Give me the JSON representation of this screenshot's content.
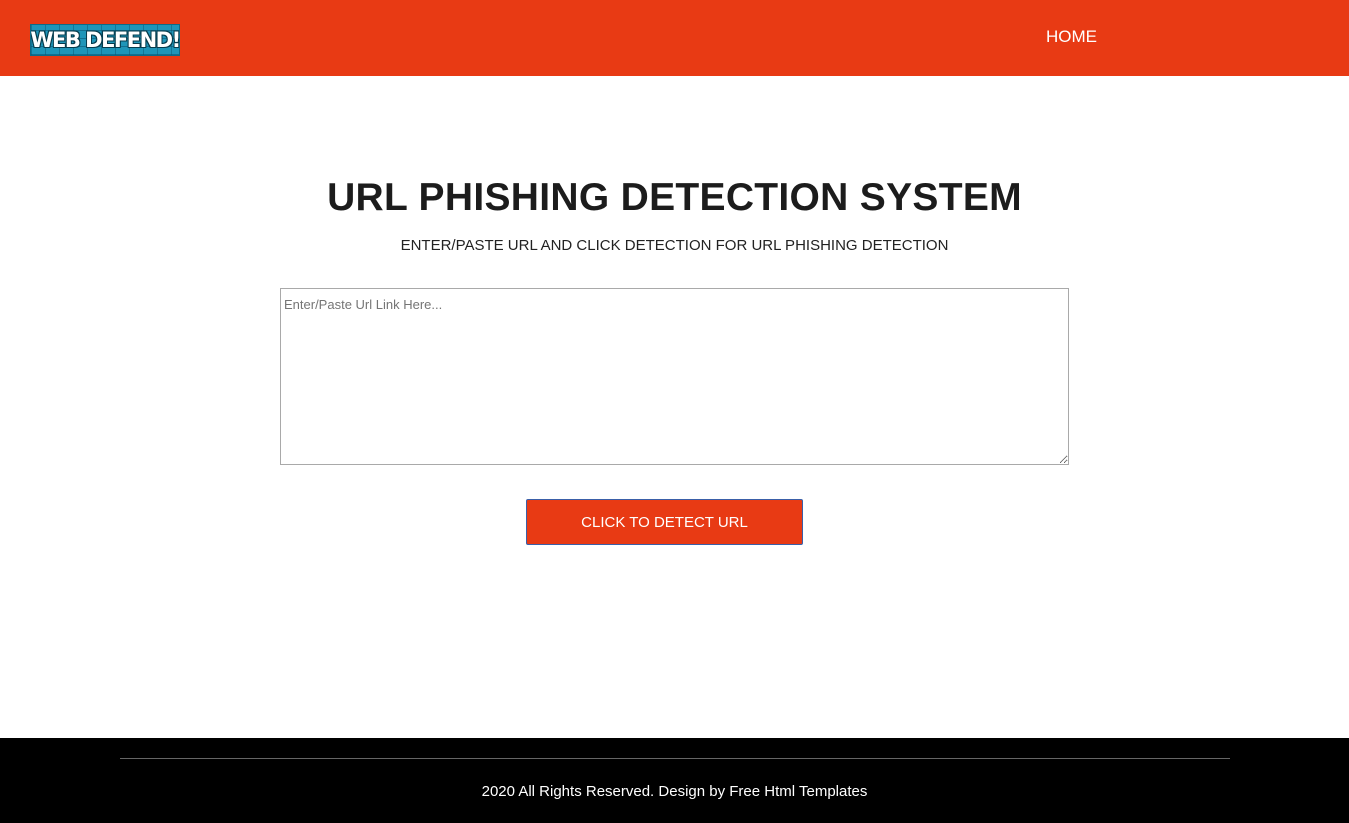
{
  "header": {
    "logo_text": "WEB DEFEND!",
    "nav": {
      "home_label": "HOME"
    },
    "background_color": "#e83a14"
  },
  "main": {
    "title": "URL PHISHING DETECTION SYSTEM",
    "subtitle": "ENTER/PASTE URL AND CLICK DETECTION FOR URL PHISHING DETECTION",
    "url_input": {
      "value": "",
      "placeholder": "Enter/Paste Url Link Here..."
    },
    "detect_button_label": "CLICK TO DETECT URL"
  },
  "footer": {
    "copyright_text": "2020 All Rights Reserved. Design by ",
    "link_text": "Free Html Templates",
    "background_color": "#000000"
  }
}
